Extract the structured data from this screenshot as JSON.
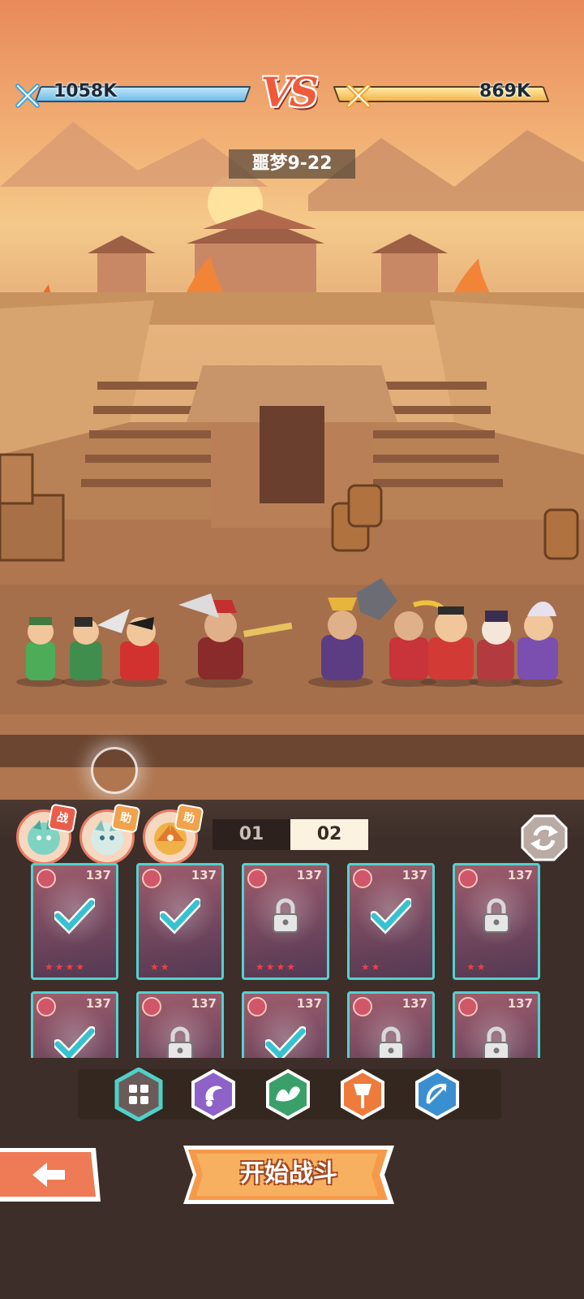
{
  "battle": {
    "left_power": "1058K",
    "right_power": "869K",
    "vs_text": "VS",
    "stage": "噩梦9-22"
  },
  "pets": [
    {
      "badge": "战",
      "color": "#7fd3c2"
    },
    {
      "badge": "助",
      "color": "#bfe0d9"
    },
    {
      "badge": "助",
      "color": "#f0b246"
    }
  ],
  "team_tabs": [
    "01",
    "02"
  ],
  "team_tab_selected": "02",
  "heroes": [
    {
      "level": "137",
      "stars": "★★★★",
      "status": "selected"
    },
    {
      "level": "137",
      "stars": "★★",
      "status": "selected"
    },
    {
      "level": "137",
      "stars": "★★★★",
      "status": "locked"
    },
    {
      "level": "137",
      "stars": "★★",
      "status": "selected"
    },
    {
      "level": "137",
      "stars": "★★",
      "status": "locked"
    },
    {
      "level": "137",
      "stars": "",
      "status": "selected"
    },
    {
      "level": "137",
      "stars": "",
      "status": "locked"
    },
    {
      "level": "137",
      "stars": "",
      "status": "selected"
    },
    {
      "level": "137",
      "stars": "",
      "status": "locked"
    },
    {
      "level": "137",
      "stars": "",
      "status": "locked"
    }
  ],
  "filters": [
    {
      "name": "all",
      "color": "#6b5b58"
    },
    {
      "name": "mage",
      "color": "#8e62c9"
    },
    {
      "name": "support",
      "color": "#3aa06a"
    },
    {
      "name": "warrior",
      "color": "#ee7a3c"
    },
    {
      "name": "archer",
      "color": "#3a8fd0"
    }
  ],
  "start_label": "开始战斗"
}
